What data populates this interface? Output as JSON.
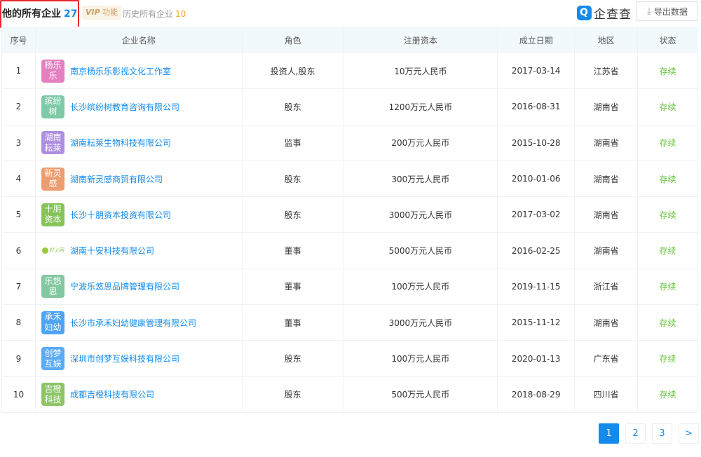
{
  "header": {
    "title": "他的所有企业",
    "count": "27",
    "vip_label": "VIP",
    "vip_text": "功能",
    "history_label": "历史所有企业",
    "history_count": "10",
    "brand": "企查查",
    "export_label": "导出数据"
  },
  "columns": [
    "序号",
    "企业名称",
    "角色",
    "注册资本",
    "成立日期",
    "地区",
    "状态"
  ],
  "rows": [
    {
      "no": "1",
      "logo": "杨乐乐",
      "logo_color": "#e580c0",
      "name": "南京杨乐乐影视文化工作室",
      "role": "投资人,股东",
      "capital": "10万元人民币",
      "date": "2017-03-14",
      "region": "江苏省",
      "status": "存续"
    },
    {
      "no": "2",
      "logo": "缤纷树",
      "logo_color": "#7ecaa6",
      "name": "长沙缤纷树教育咨询有限公司",
      "role": "股东",
      "capital": "1200万元人民币",
      "date": "2016-08-31",
      "region": "湖南省",
      "status": "存续"
    },
    {
      "no": "3",
      "logo": "湖南耘莱",
      "logo_color": "#ae8ee0",
      "name": "湖南耘莱生物科技有限公司",
      "role": "监事",
      "capital": "200万元人民币",
      "date": "2015-10-28",
      "region": "湖南省",
      "status": "存续"
    },
    {
      "no": "4",
      "logo": "新灵感",
      "logo_color": "#ec9d72",
      "name": "湖南新灵感商贸有限公司",
      "role": "股东",
      "capital": "300万元人民币",
      "date": "2010-01-06",
      "region": "湖南省",
      "status": "存续"
    },
    {
      "no": "5",
      "logo": "十朋资本",
      "logo_color": "#86c45a",
      "name": "长沙十朋资本投资有限公司",
      "role": "股东",
      "capital": "3000万元人民币",
      "date": "2017-03-02",
      "region": "湖南省",
      "status": "存续"
    },
    {
      "no": "6",
      "logo": "好上网",
      "logo_color": "",
      "name": "湖南十安科技有限公司",
      "role": "董事",
      "capital": "5000万元人民币",
      "date": "2016-02-25",
      "region": "湖南省",
      "status": "存续"
    },
    {
      "no": "7",
      "logo": "乐悠思",
      "logo_color": "#82c8a0",
      "name": "宁波乐悠思品牌管理有限公司",
      "role": "董事",
      "capital": "100万元人民币",
      "date": "2019-11-15",
      "region": "浙江省",
      "status": "存续"
    },
    {
      "no": "8",
      "logo": "承禾妇幼",
      "logo_color": "#4da3f5",
      "name": "长沙市承禾妇幼健康管理有限公司",
      "role": "董事",
      "capital": "3000万元人民币",
      "date": "2015-11-12",
      "region": "湖南省",
      "status": "存续"
    },
    {
      "no": "9",
      "logo": "创梦互娱",
      "logo_color": "#5aabf5",
      "name": "深圳市创梦互娱科技有限公司",
      "role": "股东",
      "capital": "100万元人民币",
      "date": "2020-01-13",
      "region": "广东省",
      "status": "存续"
    },
    {
      "no": "10",
      "logo": "吉橙科技",
      "logo_color": "#8cc466",
      "name": "成都吉橙科技有限公司",
      "role": "股东",
      "capital": "500万元人民币",
      "date": "2018-08-29",
      "region": "四川省",
      "status": "存续"
    }
  ],
  "pagination": {
    "pages": [
      "1",
      "2",
      "3"
    ],
    "current": "1",
    "next": ">"
  }
}
